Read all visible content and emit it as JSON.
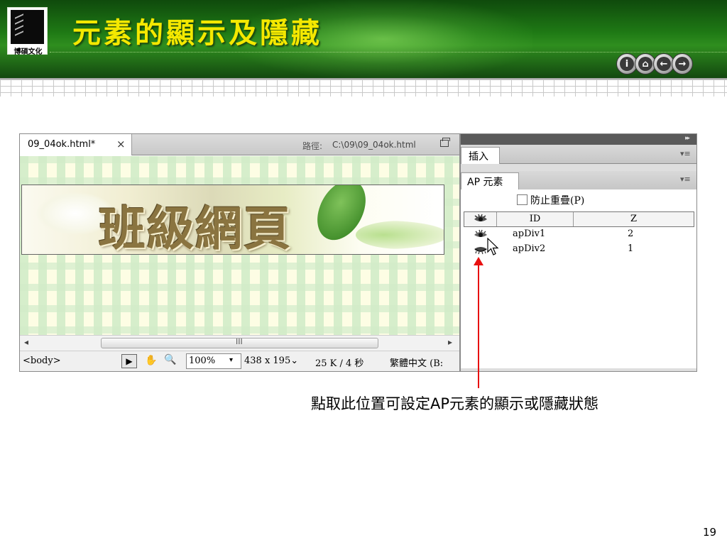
{
  "slide": {
    "title": "元素的顯示及隱藏",
    "logo_text": "博碩文化",
    "page_number": "19",
    "nav_buttons": [
      {
        "icon": "info-icon",
        "glyph": "i"
      },
      {
        "icon": "home-icon",
        "glyph": "⌂"
      },
      {
        "icon": "back-arrow-icon",
        "glyph": "←"
      },
      {
        "icon": "forward-arrow-icon",
        "glyph": "→"
      }
    ],
    "callout": {
      "text_pre": "點取此位置可設定",
      "text_bold": "AP",
      "text_post": "元素的顯示或隱藏狀態"
    }
  },
  "editor": {
    "doc_tab": "09_04ok.html*",
    "close_glyph": "×",
    "path_label": "路徑:",
    "path_value": "C:\\09\\09_04ok.html",
    "banner_text": "班級網頁",
    "scroll_left": "◂",
    "scroll_right": "▸",
    "scroll_grip": "III",
    "status": {
      "tag_selector": "<body>",
      "pointer_glyph": "▶",
      "hand_glyph": "✋",
      "zoom_glyph": "🔍",
      "zoom": "100%",
      "zoom_arrow": "▾",
      "window_size": "438 x 195⌄",
      "download_info": "25 K / 4 秒",
      "encoding": "繁體中文 (B:"
    }
  },
  "panel": {
    "collapse_glyph": "▸▸",
    "insert_tab": "插入",
    "menu_glyph": "▾≡",
    "ap_tab": "AP 元素",
    "prevent_overlap": "防止重疊(P)",
    "columns": {
      "visibility": "visibility-eye-icon",
      "id": "ID",
      "z": "Z"
    },
    "rows": [
      {
        "id": "apDiv1",
        "z": "2",
        "visibility": "visible",
        "icon": "open-eye-icon"
      },
      {
        "id": "apDiv2",
        "z": "1",
        "visibility": "hidden",
        "icon": "closed-eye-icon"
      }
    ]
  },
  "colors": {
    "title": "#f4e800",
    "header_green": "#1f7a15",
    "callout_red": "#e81010"
  }
}
